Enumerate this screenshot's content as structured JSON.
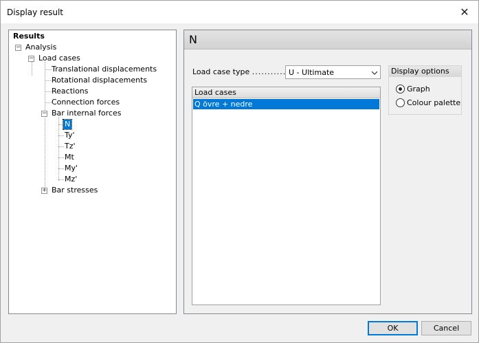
{
  "window": {
    "title": "Display result",
    "close_glyph": "✕"
  },
  "tree": {
    "root": "Results",
    "analysis": "Analysis",
    "load_cases": "Load cases",
    "items": [
      "Translational displacements",
      "Rotational displacements",
      "Reactions",
      "Connection forces",
      "Bar internal forces"
    ],
    "bar_forces": [
      "N",
      "Ty'",
      "Tz'",
      "Mt",
      "My'",
      "Mz'"
    ],
    "selected": "N",
    "bar_stresses": "Bar stresses",
    "expander_minus": "−",
    "expander_plus": "+"
  },
  "panel": {
    "header": "N",
    "load_case_type_label": "Load case type",
    "load_case_type_dots": "..............",
    "load_case_type_value": "U - Ultimate",
    "load_cases_header": "Load cases",
    "load_cases": [
      "Q övre + nedre"
    ],
    "display_options_header": "Display options",
    "options": [
      {
        "label": "Graph",
        "checked": true
      },
      {
        "label": "Colour palette",
        "checked": false
      }
    ]
  },
  "buttons": {
    "ok": "OK",
    "cancel": "Cancel"
  },
  "colors": {
    "selection": "#0078d7"
  }
}
